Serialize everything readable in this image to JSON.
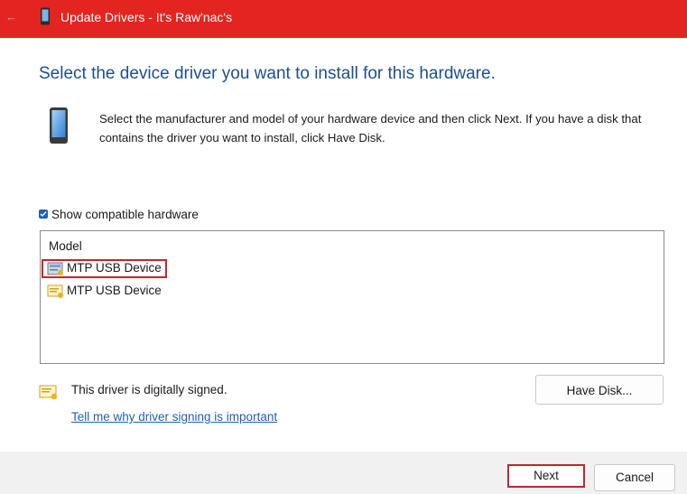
{
  "window": {
    "title": "Update Drivers - It's Raw'nac's",
    "back_icon": "back-arrow-icon",
    "app_icon": "phone-device-icon",
    "titlebar_color": "#e32420"
  },
  "main": {
    "heading": "Select the device driver you want to install for this hardware.",
    "device_icon": "phone-device-icon",
    "description": "Select the manufacturer and model of your hardware device and then click Next. If you have a disk that contains the driver you want to install, click Have Disk.",
    "show_compatible": {
      "label": "Show compatible hardware",
      "checked": true
    },
    "model_list": {
      "header": "Model",
      "items": [
        {
          "label": "MTP USB Device",
          "icon": "driver-package-icon",
          "highlighted": true
        },
        {
          "label": "MTP USB Device",
          "icon": "driver-certificate-icon",
          "highlighted": false
        }
      ]
    },
    "signed_icon": "signed-certificate-icon",
    "signed_text": "This driver is digitally signed.",
    "signing_link": "Tell me why driver signing is important",
    "have_disk_label": "Have Disk..."
  },
  "footer": {
    "next_label": "Next",
    "cancel_label": "Cancel"
  },
  "colors": {
    "accent_heading": "#1c4f8f",
    "highlight_border": "#c0262d",
    "link": "#1b62b8"
  }
}
